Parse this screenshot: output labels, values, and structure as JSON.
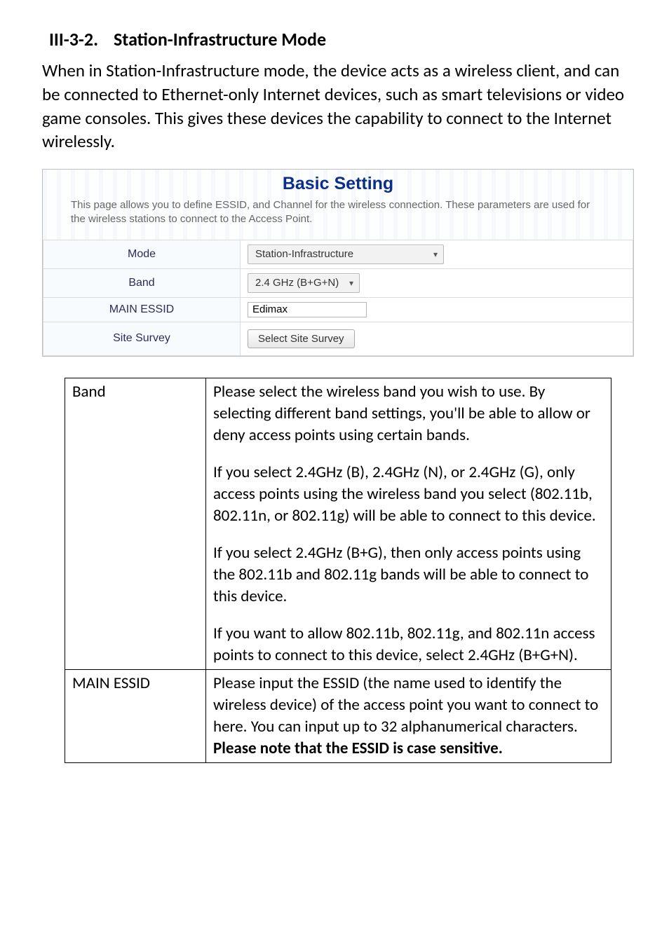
{
  "section": {
    "number": "III-3-2.",
    "title": "Station-Infrastructure Mode"
  },
  "intro": "When in Station-Infrastructure mode, the device acts as a wireless client, and can be connected to Ethernet-only Internet devices, such as smart televisions or video game consoles. This gives these devices the capability to connect to the Internet wirelessly.",
  "panel": {
    "title": "Basic Setting",
    "desc": "This page allows you to define ESSID, and Channel for the wireless connection. These parameters are used for the wireless stations to connect to the Access Point.",
    "rows": {
      "mode": {
        "label": "Mode",
        "value": "Station-Infrastructure"
      },
      "band": {
        "label": "Band",
        "value": "2.4 GHz (B+G+N)"
      },
      "essid": {
        "label": "MAIN ESSID",
        "value": "Edimax"
      },
      "survey": {
        "label": "Site Survey",
        "button": "Select Site Survey"
      }
    }
  },
  "descTable": {
    "band": {
      "label": "Band",
      "p1": "Please select the wireless band you wish to use. By selecting different band settings, you'll be able to allow or deny access points using certain bands.",
      "p2": "If you select 2.4GHz (B), 2.4GHz (N), or 2.4GHz (G), only access points using the wireless band you select (802.11b, 802.11n, or 802.11g) will be able to connect to this device.",
      "p3": "If you select 2.4GHz (B+G), then only access points using the 802.11b and 802.11g bands will be able to connect to this device.",
      "p4": "If you want to allow 802.11b, 802.11g, and 802.11n access points to connect to this device, select 2.4GHz (B+G+N)."
    },
    "essid": {
      "label": "MAIN ESSID",
      "p1": "Please input the ESSID (the name used to identify the wireless device) of the access point you want to connect to here. You can input up to 32 alphanumerical characters.",
      "p2": "Please note that the ESSID is case sensitive."
    }
  }
}
